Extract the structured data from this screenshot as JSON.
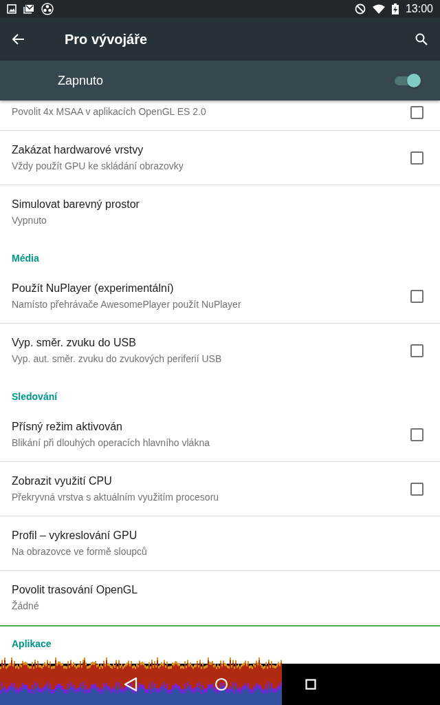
{
  "status_bar": {
    "time": "13:00"
  },
  "toolbar": {
    "title": "Pro vývojáře"
  },
  "master_switch": {
    "label": "Zapnuto",
    "on": true
  },
  "list": [
    {
      "kind": "check",
      "summary": "Povolit 4x MSAA v aplikacích OpenGL ES 2.0",
      "checked": false
    },
    {
      "kind": "check",
      "title": "Zakázat hardwarové vrstvy",
      "summary": "Vždy použít GPU ke skládání obrazovky",
      "checked": false
    },
    {
      "kind": "text",
      "title": "Simulovat barevný prostor",
      "summary": "Vypnuto"
    },
    {
      "kind": "header",
      "title": "Média"
    },
    {
      "kind": "check",
      "title": "Použít NuPlayer (experimentální)",
      "summary": "Namísto přehrávače AwesomePlayer použít NuPlayer",
      "checked": false
    },
    {
      "kind": "check",
      "title": "Vyp. směr. zvuku do USB",
      "summary": "Vyp. aut. směr. zvuku do zvukových periferií USB",
      "checked": false
    },
    {
      "kind": "header",
      "title": "Sledování"
    },
    {
      "kind": "check",
      "title": "Přísný režim aktivován",
      "summary": "Blikání při dlouhých operacích hlavního vlákna",
      "checked": false
    },
    {
      "kind": "check",
      "title": "Zobrazit využití CPU",
      "summary": "Překryvná vrstva s aktuálním využitím procesoru",
      "checked": false
    },
    {
      "kind": "text",
      "title": "Profil – vykreslování GPU",
      "summary": "Na obrazovce ve formě sloupců"
    },
    {
      "kind": "text",
      "title": "Povolit trasování OpenGL",
      "summary": "Žádné"
    },
    {
      "kind": "header",
      "title": "Aplikace"
    }
  ]
}
